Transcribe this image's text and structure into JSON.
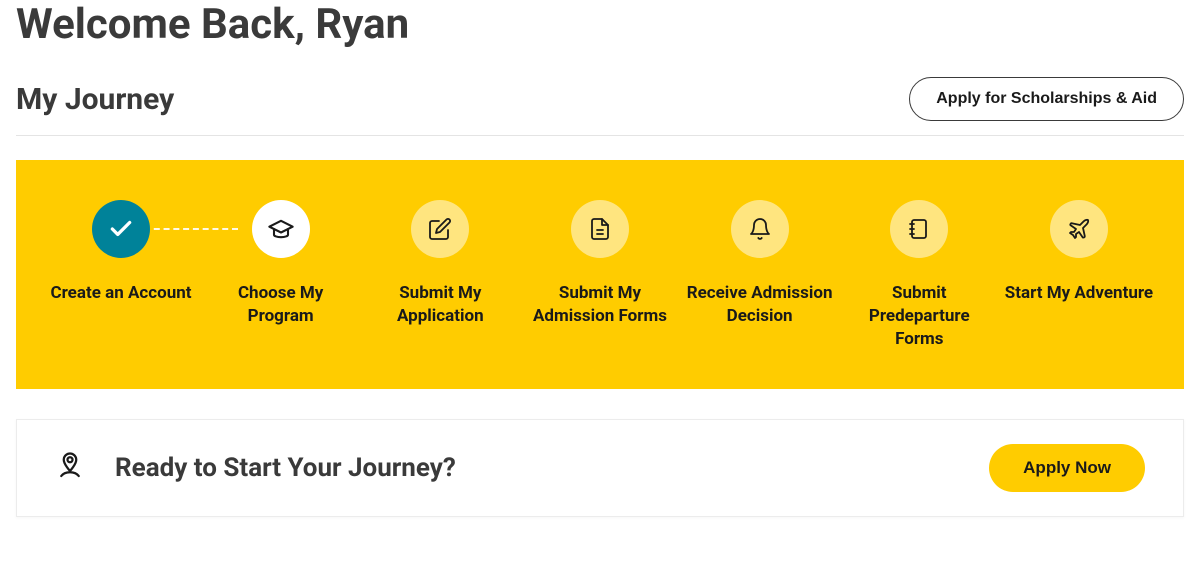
{
  "welcome_title": "Welcome Back, Ryan",
  "section_title": "My Journey",
  "scholarships_button": "Apply for Scholarships & Aid",
  "steps": [
    {
      "label": "Create an Account",
      "state": "completed",
      "icon": "check"
    },
    {
      "label": "Choose My Program",
      "state": "current",
      "icon": "grad-cap"
    },
    {
      "label": "Submit My Application",
      "state": "upcoming",
      "icon": "edit"
    },
    {
      "label": "Submit My Admission Forms",
      "state": "upcoming",
      "icon": "document"
    },
    {
      "label": "Receive Admission Decision",
      "state": "upcoming",
      "icon": "bell"
    },
    {
      "label": "Submit Predeparture Forms",
      "state": "upcoming",
      "icon": "notebook"
    },
    {
      "label": "Start My Adventure",
      "state": "upcoming",
      "icon": "plane"
    }
  ],
  "ready_card": {
    "title": "Ready to Start Your Journey?",
    "cta": "Apply Now"
  },
  "colors": {
    "brand_yellow": "#FFCC00",
    "brand_yellow_light": "#FFE57F",
    "teal": "#008299",
    "text_dark": "#3a3a3a"
  }
}
